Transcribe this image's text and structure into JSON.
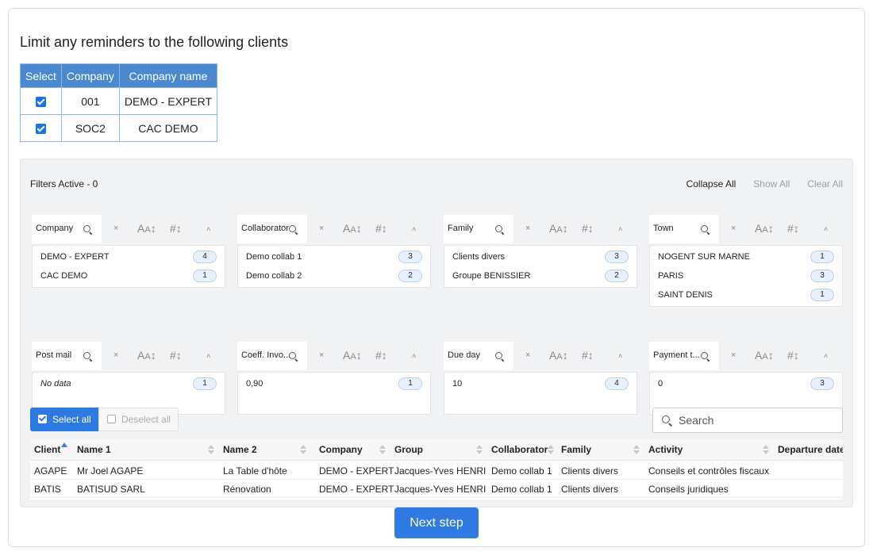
{
  "title": "Limit any reminders to the following clients",
  "clients_table": {
    "headers": [
      "Select",
      "Company",
      "Company name"
    ],
    "rows": [
      {
        "selected": true,
        "company": "001",
        "company_name": "DEMO - EXPERT"
      },
      {
        "selected": true,
        "company": "SOC2",
        "company_name": "CAC DEMO"
      }
    ]
  },
  "filters": {
    "active_label": "Filters Active - 0",
    "actions": {
      "collapse_all": "Collapse All",
      "show_all": "Show All",
      "clear_all": "Clear All"
    },
    "facets": [
      {
        "label": "Company",
        "items": [
          {
            "label": "DEMO - EXPERT",
            "count": "4"
          },
          {
            "label": "CAC DEMO",
            "count": "1"
          }
        ]
      },
      {
        "label": "Collaborator",
        "items": [
          {
            "label": "Demo collab 1",
            "count": "3"
          },
          {
            "label": "Demo collab 2",
            "count": "2"
          }
        ]
      },
      {
        "label": "Family",
        "items": [
          {
            "label": "Clients divers",
            "count": "3"
          },
          {
            "label": "Groupe BENISSIER",
            "count": "2"
          }
        ]
      },
      {
        "label": "Town",
        "items": [
          {
            "label": "NOGENT SUR MARNE",
            "count": "1"
          },
          {
            "label": "PARIS",
            "count": "3"
          },
          {
            "label": "SAINT DENIS",
            "count": "1"
          }
        ]
      },
      {
        "label": "Post mail",
        "items": [
          {
            "label": "No data",
            "count": "1"
          }
        ]
      },
      {
        "label": "Coeff. Invo...",
        "items": [
          {
            "label": "0,90",
            "count": "1"
          }
        ]
      },
      {
        "label": "Due day",
        "items": [
          {
            "label": "10",
            "count": "4"
          }
        ]
      },
      {
        "label": "Payment t...",
        "items": [
          {
            "label": "0",
            "count": "3"
          }
        ]
      }
    ],
    "icons": {
      "clear": "×",
      "sort_alpha": "A͏A↕",
      "sort_numeric": "#↕",
      "collapse": "˄"
    }
  },
  "selection": {
    "select_all": "Select all",
    "deselect_all": "Deselect all"
  },
  "search": {
    "placeholder": "Search"
  },
  "grid": {
    "columns": [
      "Client",
      "Name 1",
      "Name 2",
      "Company",
      "Group",
      "Collaborator",
      "Family",
      "Activity",
      "Departure date"
    ],
    "rows": [
      [
        "AGAPE",
        "Mr Joel AGAPE",
        "La Table d'hôte",
        "DEMO - EXPERT",
        "Jacques-Yves HENRI",
        "Demo collab 1",
        "Clients divers",
        "Conseils et contrôles fiscaux",
        ""
      ],
      [
        "BATIS",
        "BATISUD SARL",
        "Rénovation",
        "DEMO - EXPERT",
        "Jacques-Yves HENRI",
        "Demo collab 1",
        "Clients divers",
        "Conseils juridiques",
        ""
      ]
    ]
  },
  "next_step": "Next step",
  "colors": {
    "accent": "#2f7ae0",
    "table_header": "#4a89cf",
    "panel_bg": "#f1f2f4"
  }
}
